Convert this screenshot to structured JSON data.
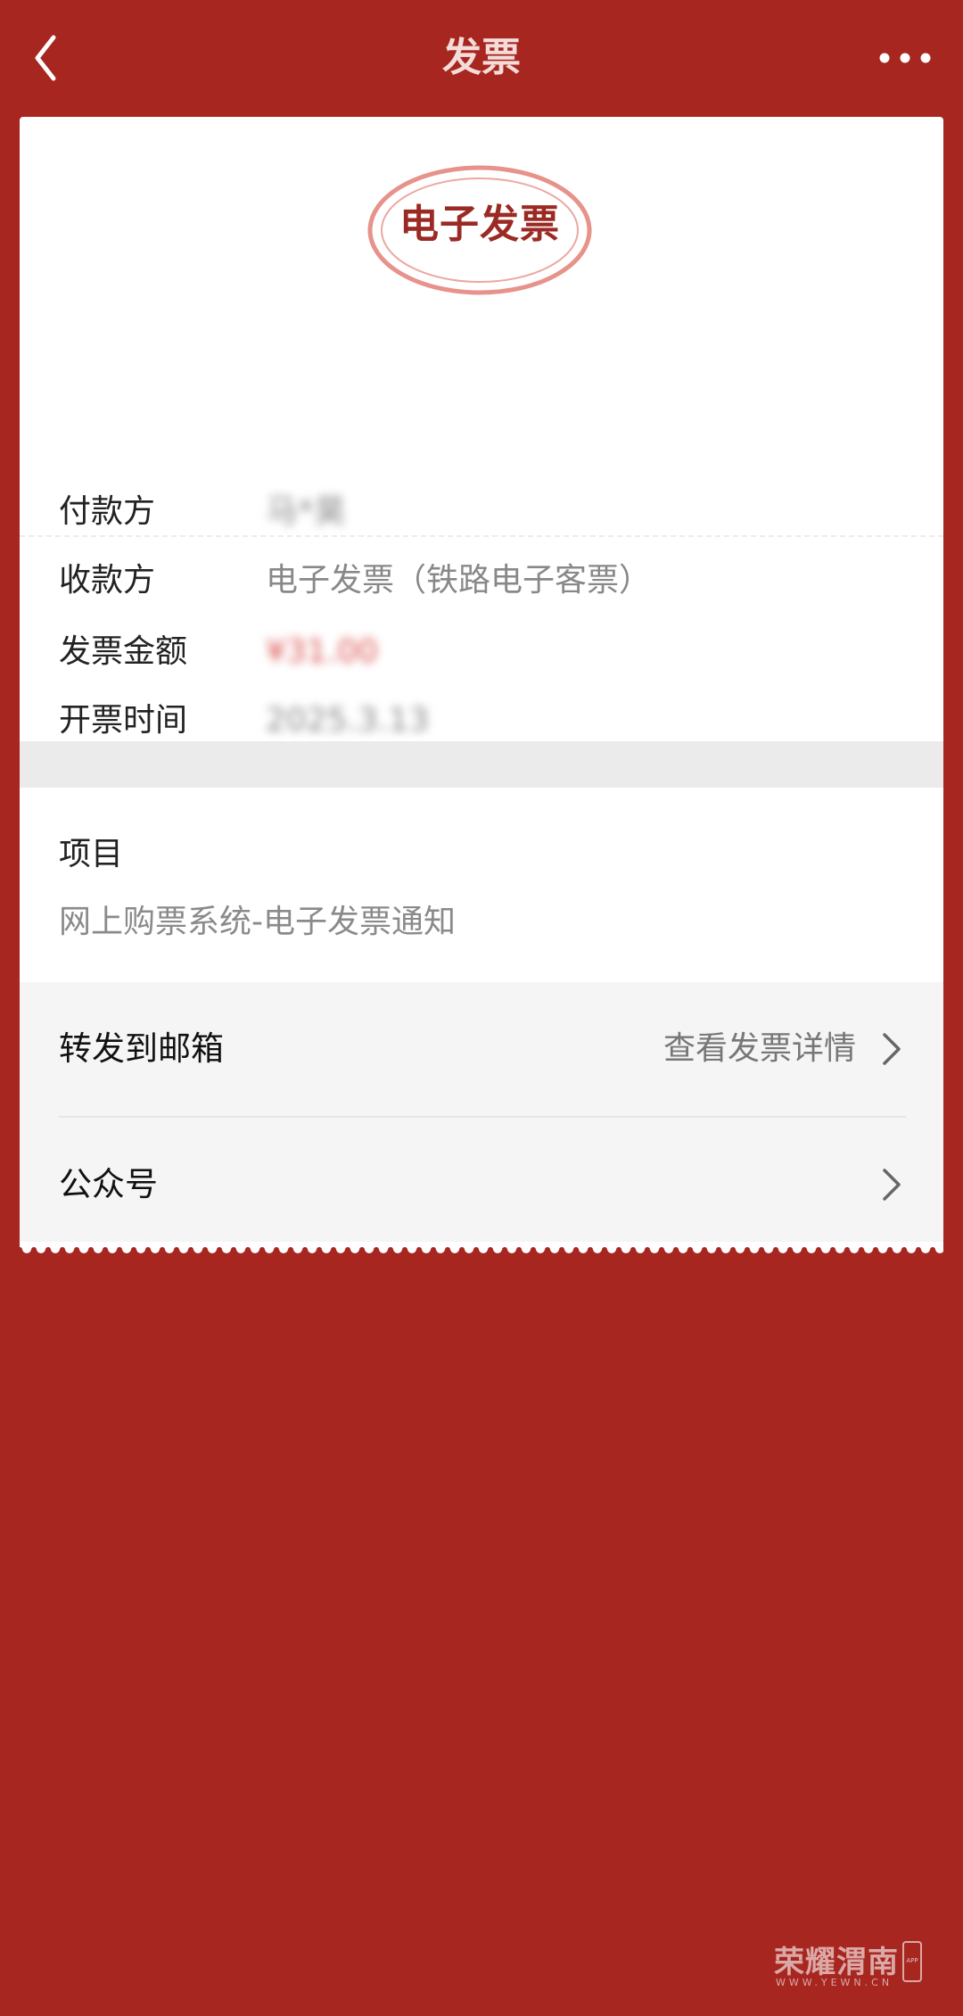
{
  "header": {
    "title": "发票",
    "back_icon": "chevron-left-icon",
    "more_icon": "more-dots-icon"
  },
  "stamp": {
    "text": "电子发票"
  },
  "invoice": {
    "payer_label": "付款方",
    "payer_value": "马*昊",
    "payee_label": "收款方",
    "payee_value": "电子发票（铁路电子客票）",
    "amount_label": "发票金额",
    "amount_value": "¥31.00",
    "date_label": "开票时间",
    "date_value": "2025.3.13"
  },
  "item": {
    "title": "项目",
    "desc": "网上购票系统-电子发票通知"
  },
  "actions": {
    "forward_label": "转发到邮箱",
    "view_details_label": "查看发票详情",
    "official_account_label": "公众号"
  },
  "watermark": {
    "text": "荣耀渭南",
    "sub": "WWW.YEWN.CN",
    "app": "APP"
  },
  "colors": {
    "background": "#a72620",
    "card": "#ffffff",
    "stamp_ring": "#e7928a",
    "amount": "#d9534f"
  }
}
